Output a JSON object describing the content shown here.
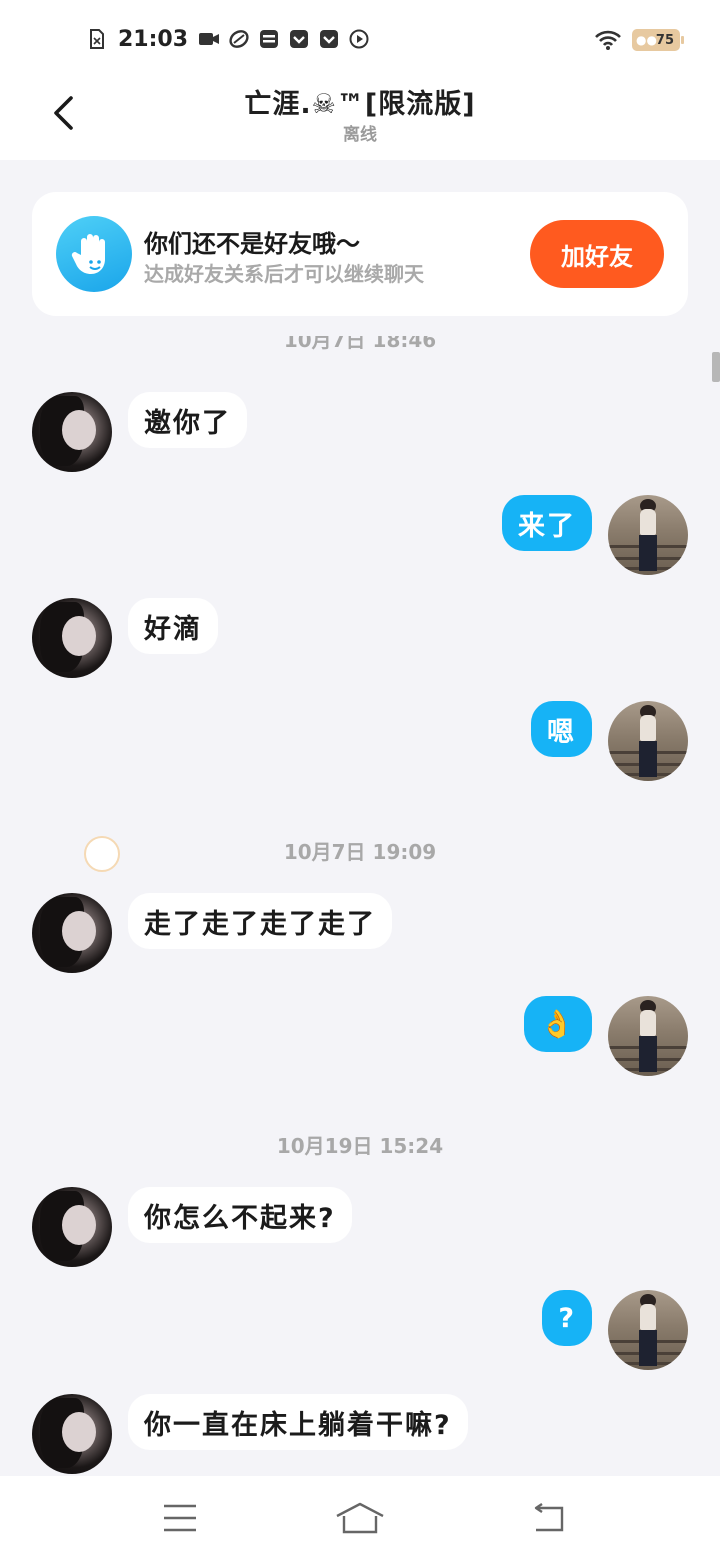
{
  "status_bar": {
    "time": "21:03",
    "battery": "75",
    "icons": [
      "sim-card-icon",
      "video-camera-icon",
      "link-icon",
      "card-icon",
      "pocket-icon",
      "pocket-icon",
      "play-icon"
    ],
    "right_icons": [
      "wifi-icon",
      "battery-icon"
    ]
  },
  "header": {
    "title": "亡涯.☠™[限流版]",
    "status": "离线",
    "back_icon": "back-arrow-icon"
  },
  "friend_card": {
    "title": "你们还不是好友哦～",
    "subtitle": "达成好友关系后才可以继续聊天",
    "button_label": "加好友",
    "icon": "waving-hand-icon"
  },
  "timestamps": {
    "partial": "10月7日 18:46",
    "t2": "10月7日 19:09",
    "t3": "10月19日 15:24"
  },
  "messages": [
    {
      "side": "left",
      "text": "邀你了"
    },
    {
      "side": "right",
      "text": "来了"
    },
    {
      "side": "left",
      "text": "好滴"
    },
    {
      "side": "right",
      "text": "嗯"
    },
    {
      "side": "left",
      "text": "走了走了走了走了"
    },
    {
      "side": "right",
      "text": "👌"
    },
    {
      "side": "left",
      "text": "你怎么不起来?"
    },
    {
      "side": "right",
      "text": "?"
    },
    {
      "side": "left",
      "text": "你一直在床上躺着干嘛?"
    }
  ],
  "nav": {
    "icons": [
      "menu-icon",
      "home-icon",
      "return-icon"
    ]
  },
  "colors": {
    "accent_blue": "#16b3f6",
    "button_orange": "#ff5a1f",
    "background": "#f4f4f8"
  }
}
